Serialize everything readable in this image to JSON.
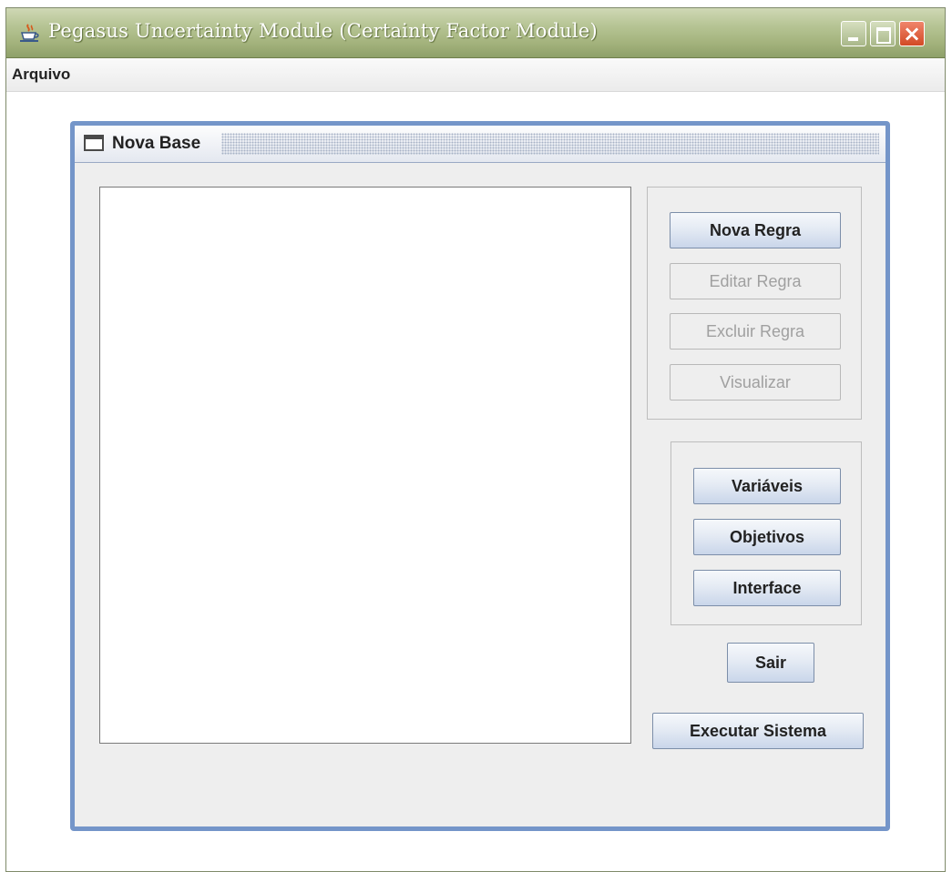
{
  "window": {
    "title": "Pegasus Uncertainty Module (Certainty Factor Module)",
    "icon": "java-cup-icon",
    "controls": {
      "minimize": "minimize-icon",
      "maximize": "maximize-icon",
      "close": "×"
    }
  },
  "menubar": {
    "items": [
      "Arquivo"
    ]
  },
  "internal_frame": {
    "title": "Nova Base",
    "icon": "window-icon"
  },
  "rules_panel": {
    "buttons": {
      "nova_regra": "Nova Regra",
      "editar_regra": "Editar Regra",
      "excluir_regra": "Excluir Regra",
      "visualizar": "Visualizar"
    }
  },
  "base_panel": {
    "buttons": {
      "variaveis": "Variáveis",
      "objetivos": "Objetivos",
      "interface": "Interface"
    }
  },
  "actions": {
    "sair": "Sair",
    "executar": "Executar Sistema"
  },
  "colors": {
    "titlebar": "#a4b37d",
    "frame_border": "#7495c9",
    "panel_bg": "#eeeeee",
    "close_button": "#d24a25"
  }
}
